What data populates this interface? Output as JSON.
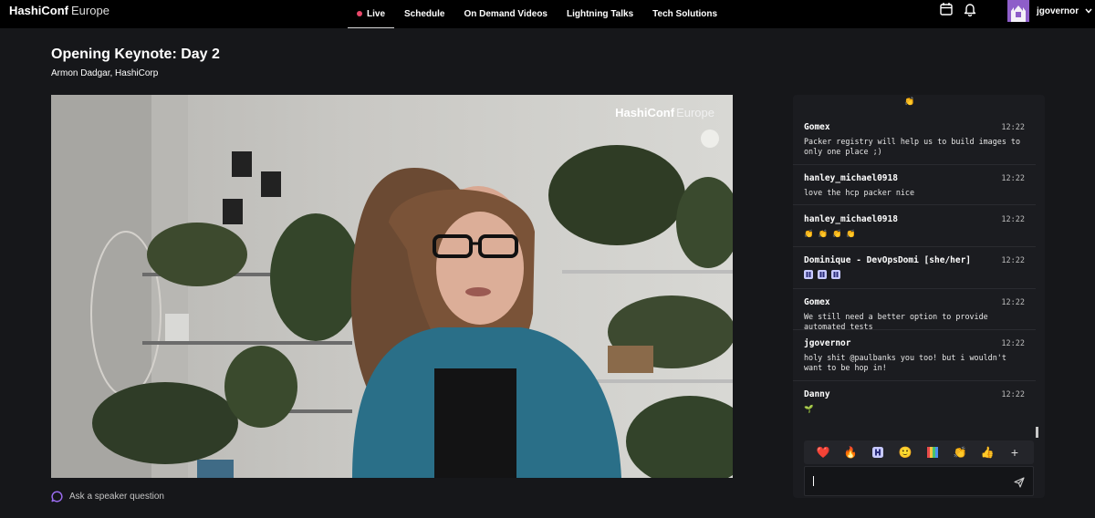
{
  "brand": {
    "bold": "HashiConf",
    "light": "Europe"
  },
  "nav": {
    "items": [
      "Live",
      "Schedule",
      "On Demand Videos",
      "Lightning Talks",
      "Tech Solutions"
    ],
    "active": "Live"
  },
  "user": {
    "name": "jgovernor"
  },
  "page": {
    "title": "Opening Keynote: Day 2",
    "speaker": "Armon Dadgar, HashiCorp"
  },
  "video": {
    "logo_bold": "HashiConf",
    "logo_light": "Europe"
  },
  "ask_question": "Ask a speaker question",
  "chat": {
    "messages": [
      {
        "user": "Gomex",
        "time": "12:22",
        "text": "Packer registry will help us to build images to only one place ;)"
      },
      {
        "user": "hanley_michael0918",
        "time": "12:22",
        "text": "love the hcp packer nice"
      },
      {
        "user": "hanley_michael0918",
        "time": "12:22",
        "text": "👏 👏 👏 👏"
      },
      {
        "user": "Dominique - DevOpsDomi [she/her]",
        "time": "12:22",
        "text": ""
      },
      {
        "user": "Gomex",
        "time": "12:22",
        "text": "We still need a better option to provide automated tests"
      },
      {
        "user": "jgovernor",
        "time": "12:22",
        "text": "holy shit @paulbanks you too! but i wouldn't want to be hop in!"
      },
      {
        "user": "Danny",
        "time": "12:22",
        "text": "🌱"
      }
    ],
    "reactions": [
      "❤️",
      "🔥",
      "hashicorp-logo",
      "🙂",
      "rainbow-logo",
      "👏",
      "👍",
      "+"
    ]
  },
  "colors": {
    "accent_live": "#e9486a",
    "avatar_bg": "#8e5ec9",
    "ask_icon": "#9b6cf0"
  }
}
